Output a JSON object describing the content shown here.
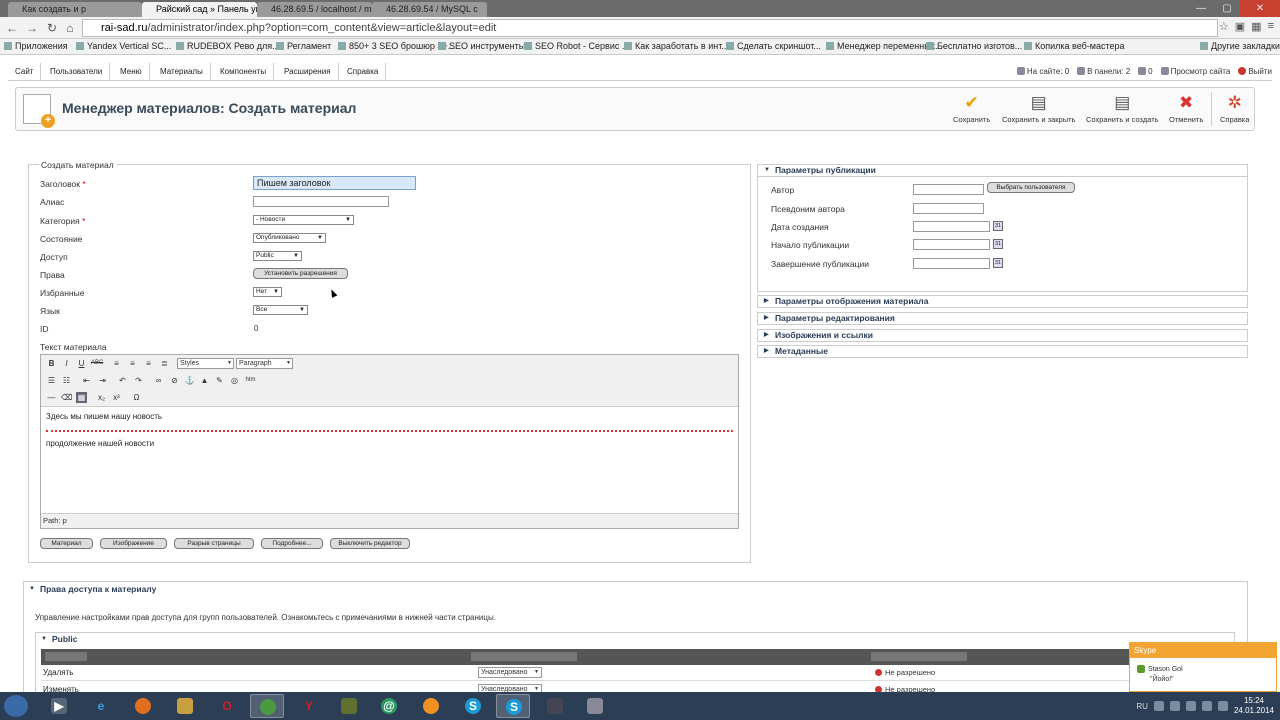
{
  "browser": {
    "tabs": [
      {
        "label": "Как создать и р"
      },
      {
        "label": "Райский сад » Панель упр"
      },
      {
        "label": "46.28.69.5 / localhost / mage"
      },
      {
        "label": "46.28.69.54 / MySQL с"
      }
    ],
    "url_host": "rai-sad.ru",
    "url_path": "/administrator/index.php?option=com_content&view=article&layout=edit",
    "bookmarks": [
      "Приложения",
      "Yandex Vertical SC...",
      "RUDEBOX Рево для...",
      "Регламент",
      "850+ 3 SEO брошюр 3+...",
      "SEO инструменты",
      "SEO Robot - Сервис ...",
      "Как заработать в инт...",
      "Сделать скриншот...",
      "Менеджер переменных...",
      "Бесплатно изготов...",
      "Копилка веб-мастера",
      "Другие закладки"
    ]
  },
  "admin_menu": {
    "items": [
      "Сайт",
      "Пользователи",
      "Меню",
      "Материалы",
      "Компоненты",
      "Расширения",
      "Справка"
    ],
    "status": {
      "on_site": "На сайте: 0",
      "in_panel": "В панели: 2",
      "messages": "0",
      "view_site": "Просмотр сайта",
      "logout": "Выйти"
    }
  },
  "header": {
    "title": "Менеджер материалов: Создать материал",
    "buttons": {
      "save": "Сохранить",
      "save_close": "Сохранить и закрыть",
      "save_new": "Сохранить и создать",
      "cancel": "Отменить",
      "help": "Справка"
    }
  },
  "form": {
    "legend": "Создать материал",
    "title_label": "Заголовок",
    "title_value": "Пишем заголовок",
    "alias_label": "Алиас",
    "category_label": "Категория",
    "category_value": "- Новости",
    "state_label": "Состояние",
    "state_value": "Опубликовано",
    "access_label": "Доступ",
    "access_value": "Public",
    "rights_label": "Права",
    "rights_button": "Установить разрешения",
    "featured_label": "Избранные",
    "featured_value": "Нет",
    "language_label": "Язык",
    "language_value": "Все",
    "id_label": "ID",
    "id_value": "0",
    "text_label": "Текст материала",
    "required_mark": "*"
  },
  "editor": {
    "styles": "Styles",
    "format": "Paragraph",
    "line1": "Здесь мы пишем нашу новость",
    "line2": "продолжение нашей новости",
    "path": "Path: p",
    "bottom_buttons": [
      "Материал",
      "Изображение",
      "Разрыв страницы",
      "Подробнее...",
      "Выключить редактор"
    ]
  },
  "publishing": {
    "header": "Параметры публикации",
    "author_label": "Автор",
    "select_user_button": "Выбрать пользователя",
    "alias_label": "Псевдоним автора",
    "created_label": "Дата создания",
    "publish_up_label": "Начало публикации",
    "publish_down_label": "Завершение публикации",
    "calendar_icon_text": "31"
  },
  "collapsed_panels": [
    "Параметры отображения материала",
    "Параметры редактирования",
    "Изображения и ссылки",
    "Метаданные"
  ],
  "access_rules": {
    "header": "Права доступа к материалу",
    "description": "Управление настройками прав доступа для групп пользователей. Ознакомьтесь с примечаниями в нижней части страницы.",
    "group": "Public",
    "rows": [
      {
        "action": "Удалять",
        "setting": "Унаследовано",
        "calculated": "Не разрешено"
      },
      {
        "action": "Изменять",
        "setting": "Унаследовано",
        "calculated": "Не разрешено"
      }
    ]
  },
  "skype_popup": {
    "title": "Skype",
    "name": "Stason Gol",
    "message": "\"Йойо!\""
  },
  "taskbar": {
    "lang": "RU",
    "time": "15:24",
    "date": "24.01.2014"
  },
  "colors": {
    "accent": "#2a3c55",
    "skype": "#f3a531",
    "required": "#cc0000"
  }
}
